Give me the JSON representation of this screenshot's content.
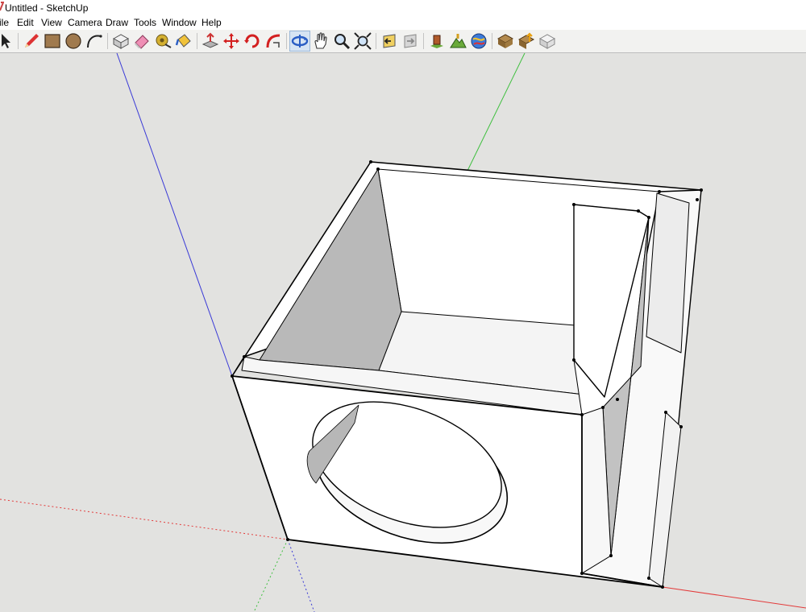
{
  "window": {
    "title": "Untitled - SketchUp"
  },
  "menu": [
    "ile",
    "Edit",
    "View",
    "Camera",
    "Draw",
    "Tools",
    "Window",
    "Help"
  ],
  "toolbar": {
    "groups": [
      [
        "select-tool"
      ],
      [
        "pencil-line-tool",
        "rectangle-tool",
        "circle-tool",
        "arc-tool"
      ],
      [
        "make-component-tool",
        "eraser-tool",
        "tape-measure-tool",
        "paint-bucket-tool"
      ],
      [
        "push-pull-tool",
        "move-tool",
        "rotate-tool",
        "follow-me-tool"
      ],
      [
        "orbit-tool",
        "pan-tool",
        "zoom-tool",
        "zoom-extents-tool"
      ],
      [
        "previous-view-tool",
        "next-view-tool"
      ],
      [
        "add-location-tool",
        "toggle-terrain-tool",
        "photo-textures-tool"
      ],
      [
        "get-models-tool",
        "share-model-tool",
        "share-component-tool"
      ]
    ],
    "active_tool": "orbit-tool"
  },
  "colors": {
    "canvas_bg": "#e2e2e0",
    "axis_red": "#e33a3a",
    "axis_green": "#3fbf3f",
    "axis_blue": "#3a3ad6",
    "face_light": "#ffffff",
    "face_shaded": "#b9b9b9",
    "edge": "#000000"
  },
  "model": {
    "name": "subwoofer-box",
    "hole": "circular-speaker-cutout"
  }
}
